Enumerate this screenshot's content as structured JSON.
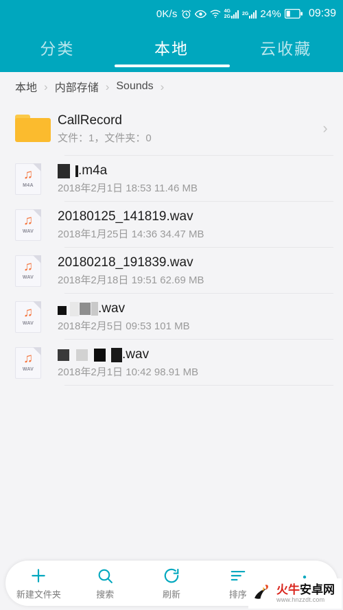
{
  "statusbar": {
    "netspeed": "0K/s",
    "icons": [
      "alarm-icon",
      "eye-icon",
      "wifi-icon",
      "4g-signal-icon",
      "2g-signal-icon"
    ],
    "net_label_top": "4G",
    "net_label_bottom": "2G",
    "net_label_secondary": "2G",
    "battery_percent": "24%",
    "time": "09:39",
    "bg_color": "#00A7BE"
  },
  "tabs": {
    "items": [
      {
        "label": "分类",
        "active": false
      },
      {
        "label": "本地",
        "active": true
      },
      {
        "label": "云收藏",
        "active": false
      }
    ]
  },
  "breadcrumb": {
    "separator": "›",
    "items": [
      "本地",
      "内部存储",
      "Sounds"
    ]
  },
  "list": {
    "folder": {
      "icon": "folder-icon",
      "name": "CallRecord",
      "meta": "文件：1，文件夹：0",
      "chevron": "›"
    },
    "files": [
      {
        "icon": "audio-file-icon",
        "ext": "M4A",
        "note_glyph": "♫",
        "name_suffix": ".m4a",
        "redactions": [
          {
            "width": 18,
            "height": 21,
            "color": "#2B2B2B",
            "gap": 8
          },
          {
            "width": 4,
            "height": 17,
            "color": "#1A1A1A",
            "gap": 0
          }
        ],
        "meta": "2018年2月1日 18:53 11.46 MB"
      },
      {
        "icon": "audio-file-icon",
        "ext": "WAV",
        "note_glyph": "♫",
        "name_suffix": "20180125_141819.wav",
        "redactions": [],
        "meta": "2018年1月25日 14:36 34.47 MB"
      },
      {
        "icon": "audio-file-icon",
        "ext": "WAV",
        "note_glyph": "♫",
        "name_suffix": "20180218_191839.wav",
        "redactions": [],
        "meta": "2018年2月18日 19:51 62.69 MB"
      },
      {
        "icon": "audio-file-icon",
        "ext": "WAV",
        "note_glyph": "♫",
        "name_suffix": ".wav",
        "redactions": [
          {
            "width": 13,
            "height": 13,
            "color": "#111111",
            "gap": 5,
            "offset": 5
          },
          {
            "width": 13,
            "height": 21,
            "color": "#E8E8E8",
            "gap": 1
          },
          {
            "width": 16,
            "height": 18,
            "color": "#8E8E8E",
            "gap": 1
          },
          {
            "width": 10,
            "height": 20,
            "color": "#C9C9C9",
            "gap": 0
          }
        ],
        "meta": "2018年2月5日 09:53 101 MB"
      },
      {
        "icon": "audio-file-icon",
        "ext": "WAV",
        "note_glyph": "♫",
        "name_suffix": ".wav",
        "redactions": [
          {
            "width": 17,
            "height": 17,
            "color": "#3A3A3A",
            "gap": 10
          },
          {
            "width": 17,
            "height": 17,
            "color": "#D2D2D2",
            "gap": 9
          },
          {
            "width": 17,
            "height": 19,
            "color": "#0D0D0D",
            "gap": 8
          },
          {
            "width": 16,
            "height": 21,
            "color": "#1A1A1A",
            "gap": 0
          }
        ],
        "meta": "2018年2月1日 10:42 98.91 MB"
      }
    ]
  },
  "bottombar": {
    "items": [
      {
        "icon": "plus-icon",
        "label": "新建文件夹"
      },
      {
        "icon": "search-icon",
        "label": "搜索"
      },
      {
        "icon": "refresh-icon",
        "label": "刷新"
      },
      {
        "icon": "sort-icon",
        "label": "排序"
      },
      {
        "icon": "more-vertical-icon",
        "label": ""
      }
    ],
    "accent_color": "#00A7BE"
  },
  "watermark": {
    "name_part1": "火牛",
    "name_part2": "安卓网",
    "url": "www.hnzzdt.com"
  }
}
